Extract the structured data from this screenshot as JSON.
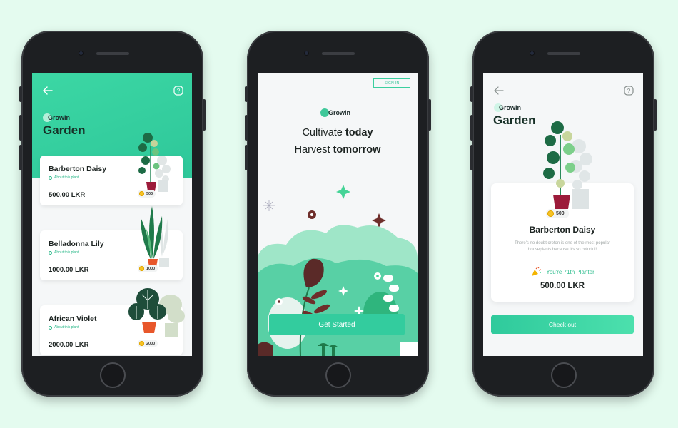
{
  "colors": {
    "background": "#e4fbef",
    "accent": "#33cc9e",
    "header": "#3cd7a4",
    "coin": "#f7c325"
  },
  "screen1": {
    "brand": "GrowIn",
    "title": "Garden",
    "back_icon": "arrow-left-icon",
    "help_icon": "help-icon",
    "plants": [
      {
        "name": "Barberton Daisy",
        "about": "About this plant",
        "price": "500.00 LKR",
        "coins": "500"
      },
      {
        "name": "Belladonna Lily",
        "about": "About this plant",
        "price": "1000.00 LKR",
        "coins": "1000"
      },
      {
        "name": "African Violet",
        "about": "About this plant",
        "price": "2000.00 LKR",
        "coins": "2000"
      }
    ]
  },
  "screen2": {
    "signin": "SIGN IN",
    "brand": "GrowIn",
    "line1_normal": "Cultivate ",
    "line1_bold": "today",
    "line2_normal": "Harvest ",
    "line2_bold": "tomorrow",
    "cta": "Get Started"
  },
  "screen3": {
    "brand": "GrowIn",
    "title": "Garden",
    "coins": "500",
    "plant_name": "Barberton Daisy",
    "description": "There's no doubt croton is one of the most popular houseplants because it's so colorful!",
    "planter": "You're 71th Planter",
    "price": "500.00 LKR",
    "checkout": "Check out"
  }
}
